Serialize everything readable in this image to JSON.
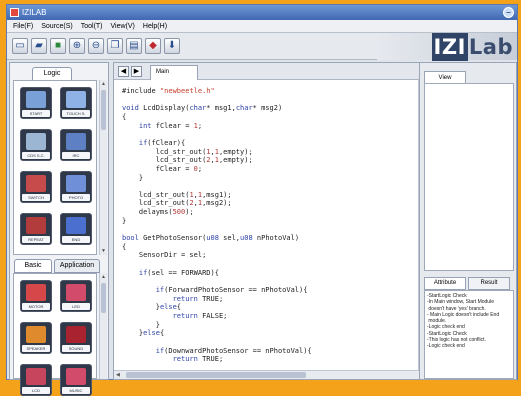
{
  "window": {
    "title": "IZILAB",
    "close_icon": "close-icon"
  },
  "menu": [
    "File(F)",
    "Source(S)",
    "Tool(T)",
    "View(V)",
    "Help(H)"
  ],
  "toolbar": {
    "icons": [
      "new-file-icon",
      "open-folder-icon",
      "save-icon",
      "zoom-in-icon",
      "zoom-out-icon",
      "copy-icon",
      "paste-icon",
      "run-icon",
      "download-icon"
    ],
    "brand": "IZILab"
  },
  "left_panel": {
    "top_tab": "Logic",
    "logic_blocks": [
      {
        "label": "START",
        "color": "#7aa0d8"
      },
      {
        "label": "TOUCH S.",
        "color": "#8fb2e6"
      },
      {
        "label": "CDS S.C.",
        "color": "#9ab6d2"
      },
      {
        "label": "IRC",
        "color": "#5d7fc4"
      },
      {
        "label": "SWITCH",
        "color": "#c74b4b"
      },
      {
        "label": "PHOTO",
        "color": "#6f8fd8"
      },
      {
        "label": "REPEAT",
        "color": "#b23c3c"
      },
      {
        "label": "END",
        "color": "#4a6fcf"
      }
    ],
    "bottom_tabs": [
      "Basic",
      "Application"
    ],
    "basic_blocks": [
      {
        "label": "MOTOR",
        "color": "#d6474a"
      },
      {
        "label": "LED",
        "color": "#d24b6b"
      },
      {
        "label": "SPEAKER",
        "color": "#e08a2e"
      },
      {
        "label": "SOUND",
        "color": "#a8232f"
      },
      {
        "label": "LCD",
        "color": "#c7465e"
      },
      {
        "label": "MUSIC",
        "color": "#d24b6b"
      }
    ]
  },
  "editor": {
    "nav": [
      "◀",
      "▶"
    ],
    "tab": "Main",
    "lines": [
      "#include \"newbeetle.h\"",
      "",
      "void LcdDisplay(char* msg1,char* msg2)",
      "{",
      "    int fClear = 1;",
      "",
      "    if(fClear){",
      "        lcd_str_out(1,1,empty);",
      "        lcd_str_out(2,1,empty);",
      "        fClear = 0;",
      "    }",
      "",
      "    lcd_str_out(1,1,msg1);",
      "    lcd_str_out(2,1,msg2);",
      "    delayms(500);",
      "}",
      "",
      "bool GetPhotoSensor(u08 sel,u08 nPhotoVal)",
      "{",
      "    SensorDir = sel;",
      "",
      "    if(sel == FORWARD){",
      "",
      "        if(ForwardPhotoSensor == nPhotoVal){",
      "            return TRUE;",
      "        }else{",
      "            return FALSE;",
      "        }",
      "    }else{",
      "",
      "        if(DownwardPhotoSensor == nPhotoVal){",
      "            return TRUE;"
    ]
  },
  "right_panel": {
    "view_tab": "View",
    "tabs": [
      "Attribute",
      "Result"
    ],
    "messages": [
      "-StartLogic Check",
      "-In Main window, Start Module",
      " doesn't have 'yes' branch.",
      "- Main Logic doesn't include End",
      " module.",
      "-Logic check end",
      "-StartLogic Check",
      "-This logic has not conflict.",
      "-Logic check end"
    ]
  }
}
